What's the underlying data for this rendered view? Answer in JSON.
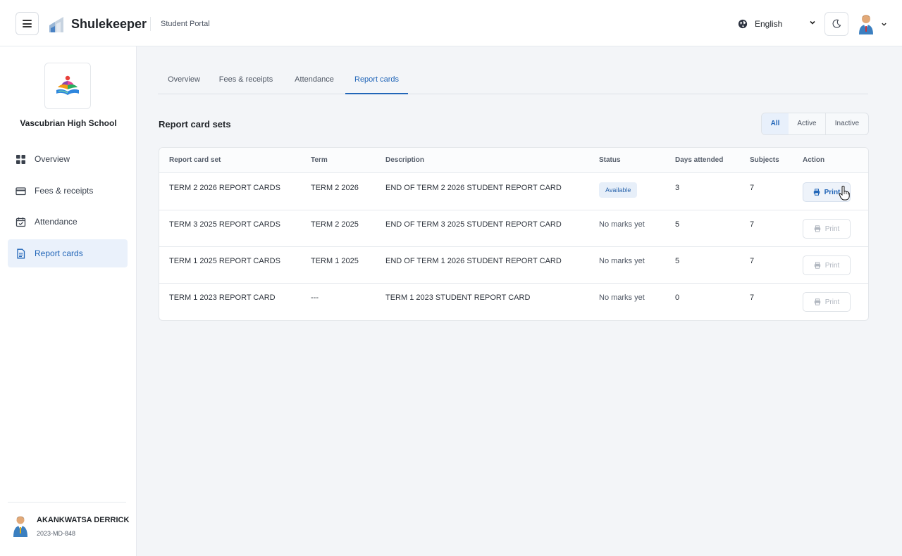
{
  "header": {
    "brand": "Shulekeeper",
    "portal": "Student Portal",
    "language": "English"
  },
  "sidebar": {
    "school_name": "Vascubrian High School",
    "items": [
      {
        "label": "Overview",
        "icon": "grid-icon"
      },
      {
        "label": "Fees & receipts",
        "icon": "card-icon"
      },
      {
        "label": "Attendance",
        "icon": "calendar-icon"
      },
      {
        "label": "Report cards",
        "icon": "document-icon",
        "active": true
      }
    ],
    "user": {
      "name": "AKANKWATSA DERRICK",
      "id": "2023-MD-848"
    }
  },
  "tabs": [
    {
      "label": "Overview"
    },
    {
      "label": "Fees & receipts"
    },
    {
      "label": "Attendance"
    },
    {
      "label": "Report cards",
      "active": true
    }
  ],
  "section": {
    "title": "Report card sets",
    "filters": [
      {
        "label": "All",
        "active": true
      },
      {
        "label": "Active"
      },
      {
        "label": "Inactive"
      }
    ]
  },
  "table": {
    "columns": [
      "Report card set",
      "Term",
      "Description",
      "Status",
      "Days attended",
      "Subjects",
      "Action"
    ],
    "rows": [
      {
        "set": "TERM 2 2026 REPORT CARDS",
        "term": "TERM 2 2026",
        "description": "END OF TERM 2 2026 STUDENT REPORT CARD",
        "status": "Available",
        "days": "3",
        "subjects": "7",
        "action": "Print",
        "enabled": true
      },
      {
        "set": "TERM 3 2025 REPORT CARDS",
        "term": "TERM 2 2025",
        "description": "END OF TERM 3 2025 STUDENT REPORT CARD",
        "status": "No marks yet",
        "days": "5",
        "subjects": "7",
        "action": "Print",
        "enabled": false
      },
      {
        "set": "TERM 1 2025 REPORT CARDS",
        "term": "TERM 1 2025",
        "description": "END OF TERM 1 2026 STUDENT REPORT CARD",
        "status": "No marks yet",
        "days": "5",
        "subjects": "7",
        "action": "Print",
        "enabled": false
      },
      {
        "set": "TERM 1 2023 REPORT CARD",
        "term": "---",
        "description": "TERM 1 2023 STUDENT REPORT CARD",
        "status": "No marks yet",
        "days": "0",
        "subjects": "7",
        "action": "Print",
        "enabled": false
      }
    ]
  },
  "colors": {
    "accent": "#2266b8",
    "active_bg": "#eaf1fb",
    "badge_bg": "#e7eff9"
  }
}
